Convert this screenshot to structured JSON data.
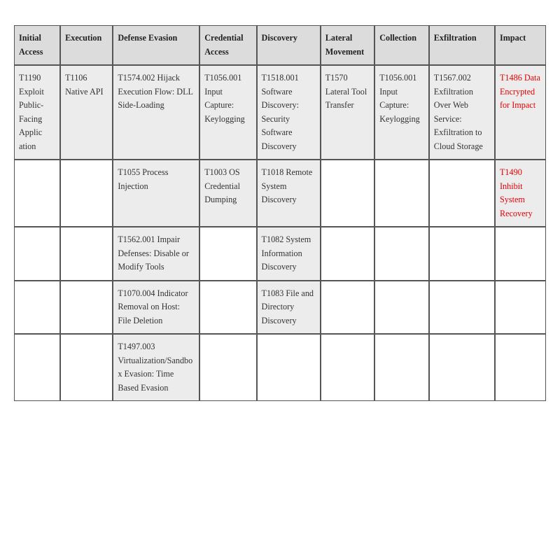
{
  "headers": {
    "c0": "Initial Access",
    "c1": "Execution",
    "c2": "Defense Evasion",
    "c3": "Credential Access",
    "c4": "Discovery",
    "c5": "Lateral Movement",
    "c6": "Collection",
    "c7": "Exfiltration",
    "c8": "Impact"
  },
  "cells": {
    "initial_access_0": "T1190 Exploit Public-Facing Applic ation",
    "execution_0": "T1106 Native API",
    "defense_evasion_0": "T1574.002 Hijack Execution Flow: DLL Side-Loading",
    "defense_evasion_1": "T1055 Process Injection",
    "defense_evasion_2": "T1562.001 Impair Defenses: Disable or Modify Tools",
    "defense_evasion_3": "T1070.004 Indicator Removal on Host: File Deletion",
    "defense_evasion_4": "T1497.003 Virtualization/Sandbox Evasion: Time Based Evasion",
    "credential_access_0": "T1056.001 Input Capture: Keylogging",
    "credential_access_1": "T1003 OS Credential Dumping",
    "discovery_0": "T1518.001 Software Discovery: Security Software Discovery",
    "discovery_1": "T1018 Remote System Discovery",
    "discovery_2": "T1082 System Information Discovery",
    "discovery_3": "T1083 File and Directory Discovery",
    "lateral_movement_0": "T1570 Lateral Tool Transfer",
    "collection_0": "T1056.001 Input Capture: Keylogging",
    "exfiltration_0": "T1567.002 Exfiltration Over Web Service: Exfiltration to Cloud Storage",
    "impact_0": "T1486 Data Encrypted for Impact",
    "impact_1": "T1490 Inhibit System Recovery"
  }
}
